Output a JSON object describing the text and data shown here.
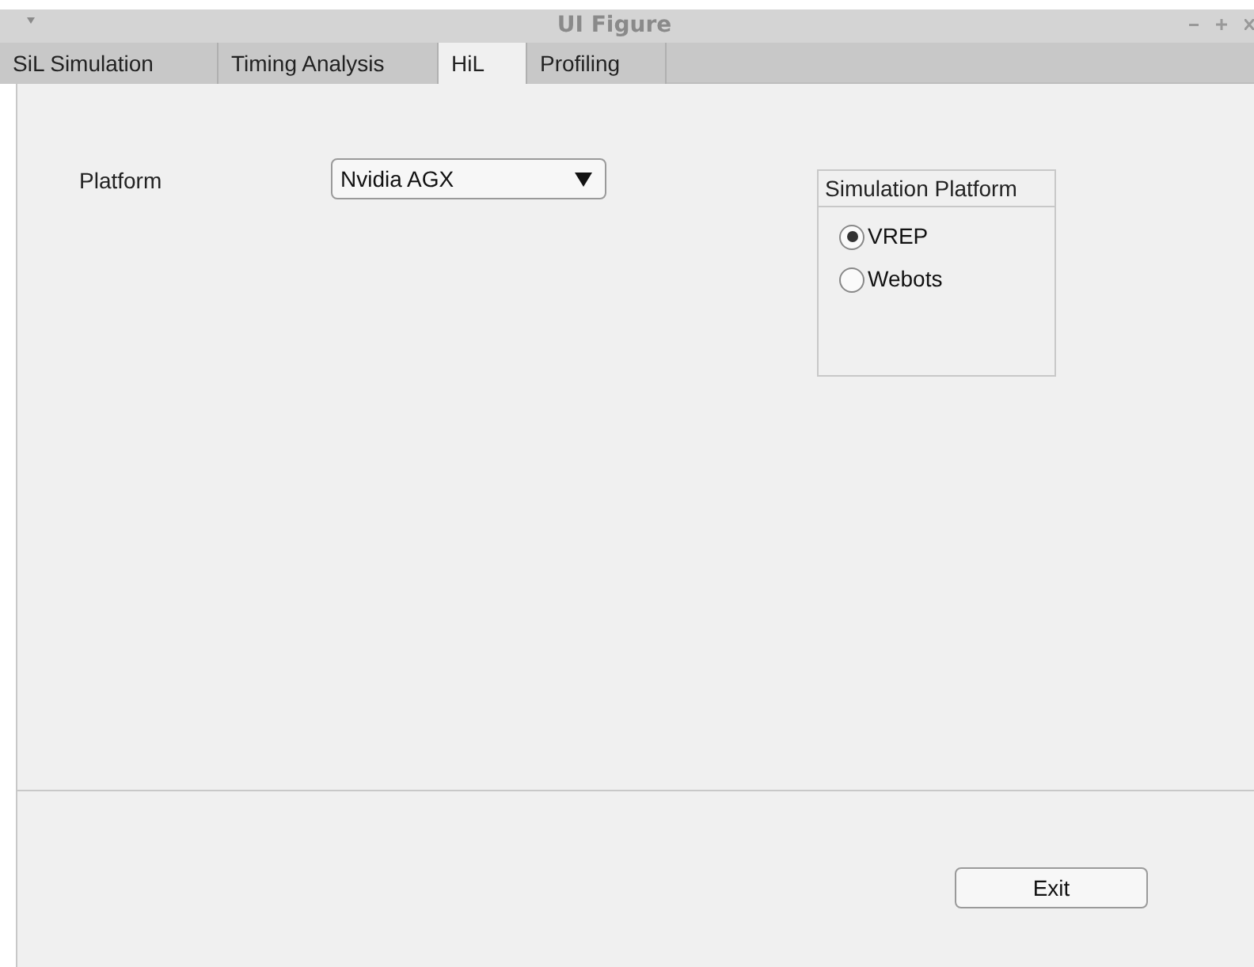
{
  "window": {
    "title": "UI Figure"
  },
  "tabs": [
    {
      "label": "SiL Simulation",
      "selected": false
    },
    {
      "label": "Timing Analysis",
      "selected": false
    },
    {
      "label": "HiL",
      "selected": true
    },
    {
      "label": "Profiling",
      "selected": false
    }
  ],
  "platform": {
    "label": "Platform",
    "value": "Nvidia AGX"
  },
  "simulation_platform": {
    "title": "Simulation Platform",
    "options": [
      {
        "label": "VREP",
        "selected": true
      },
      {
        "label": "Webots",
        "selected": false
      }
    ]
  },
  "buttons": [
    {
      "label": "Exit"
    }
  ]
}
